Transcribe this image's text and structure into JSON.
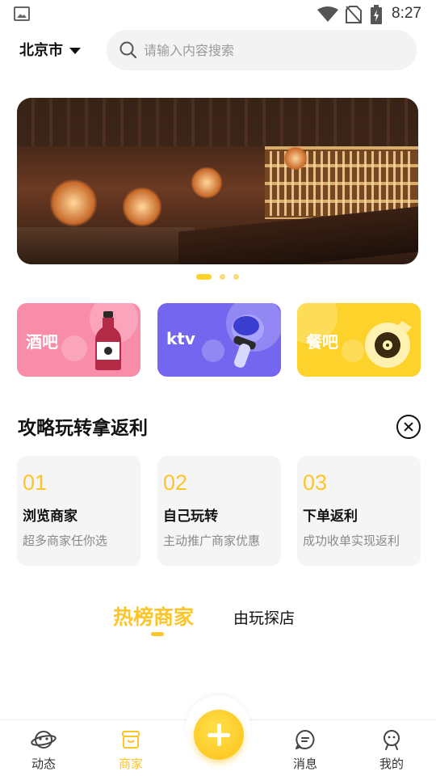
{
  "status_bar": {
    "time": "8:27"
  },
  "header": {
    "city": "北京市",
    "search_placeholder": "请输入内容搜索"
  },
  "banner": {
    "dot_count": 3,
    "active_dot": 0
  },
  "categories": [
    {
      "label": "酒吧",
      "color": "#f98ca8"
    },
    {
      "label": "ktv",
      "color": "#7566f0"
    },
    {
      "label": "餐吧",
      "color": "#fdd22a"
    }
  ],
  "guide": {
    "title": "攻略玩转拿返利",
    "steps": [
      {
        "num": "01",
        "title": "浏览商家",
        "desc": "超多商家任你选"
      },
      {
        "num": "02",
        "title": "自己玩转",
        "desc": "主动推广商家优惠"
      },
      {
        "num": "03",
        "title": "下单返利",
        "desc": "成功收单实现返利"
      }
    ]
  },
  "tabs": {
    "active": "热榜商家",
    "other": "由玩探店"
  },
  "bottom_nav": [
    {
      "label": "动态",
      "icon": "planet-icon"
    },
    {
      "label": "商家",
      "icon": "store-icon",
      "active": true
    },
    {
      "label": "消息",
      "icon": "message-icon"
    },
    {
      "label": "我的",
      "icon": "user-icon"
    }
  ],
  "colors": {
    "accent": "#fdc52a",
    "bar": "#f98ca8",
    "ktv": "#7566f0",
    "food": "#fdd22a"
  }
}
